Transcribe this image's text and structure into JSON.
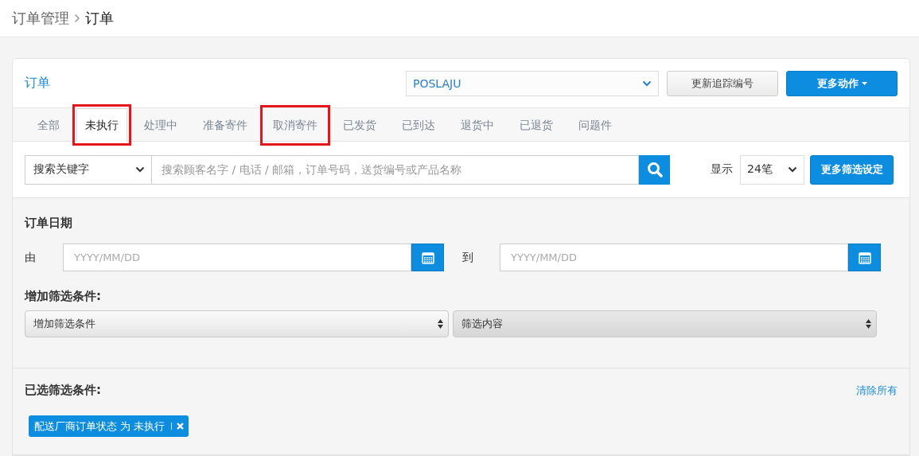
{
  "breadcrumb": [
    {
      "label": "订单管理",
      "current": false
    },
    {
      "label": "订单",
      "current": true
    }
  ],
  "header": {
    "title": "订单",
    "carrier_select": "POSLAJU",
    "buttons": [
      {
        "label": "更新追踪编号",
        "kind": "default",
        "caret": false
      },
      {
        "label": "更多动作",
        "kind": "primary",
        "caret": true
      }
    ]
  },
  "tabs": [
    {
      "label": "全部",
      "selected": false,
      "highlighted": false
    },
    {
      "label": "未执行",
      "selected": true,
      "highlighted": true
    },
    {
      "label": "处理中",
      "selected": false,
      "highlighted": false
    },
    {
      "label": "准备寄件",
      "selected": false,
      "highlighted": false
    },
    {
      "label": "取消寄件",
      "selected": false,
      "highlighted": true
    },
    {
      "label": "已发货",
      "selected": false,
      "highlighted": false
    },
    {
      "label": "已到达",
      "selected": false,
      "highlighted": false
    },
    {
      "label": "退货中",
      "selected": false,
      "highlighted": false
    },
    {
      "label": "已退货",
      "selected": false,
      "highlighted": false
    },
    {
      "label": "问题件",
      "selected": false,
      "highlighted": false
    }
  ],
  "search": {
    "keyword_select": "搜索关键字",
    "placeholder": "搜索顾客名字 / 电话 / 邮箱，订单号码，送货编号或产品名称",
    "page_size_label": "显示",
    "page_size": "24笔",
    "more_filters_button": "更多筛选设定"
  },
  "date_filter": {
    "title": "订单日期",
    "from_label": "由",
    "from_placeholder": "YYYY/MM/DD",
    "to_label": "到",
    "to_placeholder": "YYYY/MM/DD"
  },
  "add_filter": {
    "title": "增加筛选条件:",
    "selects": [
      {
        "value": "增加筛选条件"
      },
      {
        "value": "筛选内容"
      }
    ]
  },
  "selected_filters": {
    "title": "已选筛选条件:",
    "clear_link": "清除所有",
    "tags": [
      {
        "label": "配送厂商订单状态 为 未执行"
      }
    ]
  }
}
